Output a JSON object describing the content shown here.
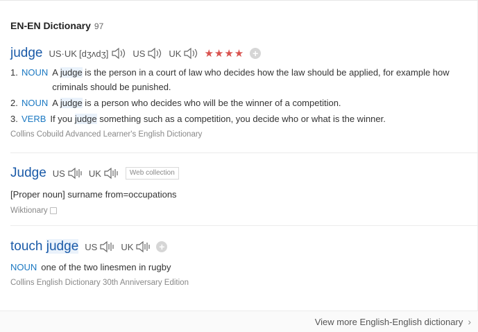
{
  "header": {
    "title": "EN-EN Dictionary",
    "count": "97"
  },
  "entries": [
    {
      "headword": "judge",
      "pron": {
        "us_uk_label": "US·UK",
        "ipa": "[dʒʌdʒ]",
        "us_label": "US",
        "uk_label": "UK"
      },
      "stars": "★★★★",
      "senses": [
        {
          "num": "1.",
          "pos": "NOUN",
          "def_pre": "A ",
          "def_hl": "judge",
          "def_post": " is the person in a court of law who decides how the law should be applied, for example how criminals should be punished."
        },
        {
          "num": "2.",
          "pos": "NOUN",
          "def_pre": "A ",
          "def_hl": "judge",
          "def_post": " is a person who decides who will be the winner of a competition."
        },
        {
          "num": "3.",
          "pos": "VERB",
          "def_pre": "If you ",
          "def_hl": "judge",
          "def_post": " something such as a competition, you decide who or what is the winner."
        }
      ],
      "source": "Collins Cobuild Advanced Learner's English Dictionary"
    },
    {
      "headword": "Judge",
      "pron": {
        "us_label": "US",
        "uk_label": "UK"
      },
      "tag": "Web collection",
      "text": "[Proper noun] surname from=occupations",
      "source": "Wiktionary"
    },
    {
      "headword_pre": "touch ",
      "headword_hl": "judge",
      "pron": {
        "us_label": "US",
        "uk_label": "UK"
      },
      "sense": {
        "pos": "NOUN",
        "def": "one of the two linesmen in rugby"
      },
      "source": "Collins English Dictionary 30th Anniversary Edition"
    }
  ],
  "footer": {
    "more_label": "View more English-English dictionary"
  },
  "colors": {
    "link": "#1a5aa8",
    "pos": "#1a78c2",
    "stars": "#d9534f",
    "highlight": "#eaf2fb"
  }
}
